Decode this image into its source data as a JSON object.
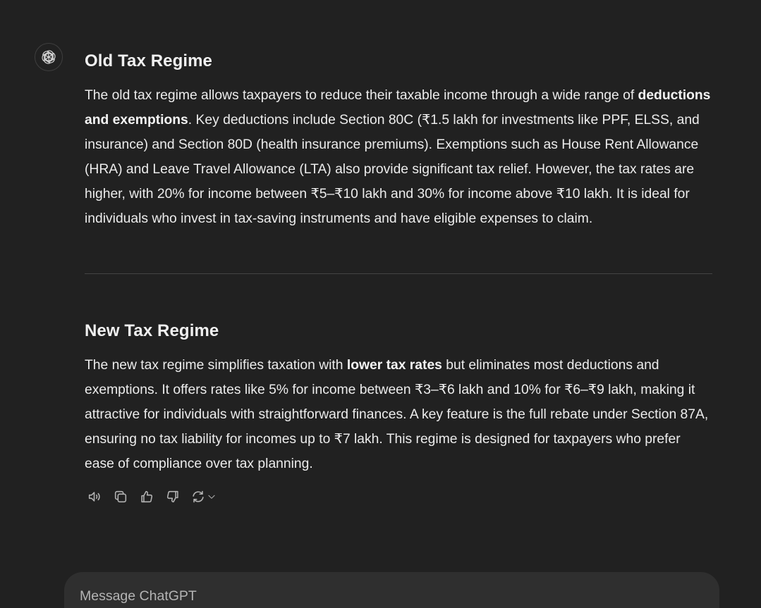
{
  "assistant": {
    "avatar_icon": "openai-logo-icon"
  },
  "sections": [
    {
      "title": "Old Tax Regime",
      "p_before": "The old tax regime allows taxpayers to reduce their taxable income through a wide range of ",
      "p_bold": "deductions and exemptions",
      "p_after": ". Key deductions include Section 80C (₹1.5 lakh for investments like PPF, ELSS, and insurance) and Section 80D (health insurance premiums). Exemptions such as House Rent Allowance (HRA) and Leave Travel Allowance (LTA) also provide significant tax relief. However, the tax rates are higher, with 20% for income between ₹5–₹10 lakh and 30% for income above ₹10 lakh. It is ideal for individuals who invest in tax-saving instruments and have eligible expenses to claim."
    },
    {
      "title": "New Tax Regime",
      "p_before": "The new tax regime simplifies taxation with ",
      "p_bold": "lower tax rates",
      "p_after": " but eliminates most deductions and exemptions. It offers rates like 5% for income between ₹3–₹6 lakh and 10% for ₹6–₹9 lakh, making it attractive for individuals with straightforward finances. A key feature is the full rebate under Section 87A, ensuring no tax liability for incomes up to ₹7 lakh. This regime is designed for taxpayers who prefer ease of compliance over tax planning."
    }
  ],
  "actions": {
    "icons": [
      "read-aloud-icon",
      "copy-icon",
      "thumbs-up-icon",
      "thumbs-down-icon",
      "regenerate-icon",
      "chevron-down-icon"
    ]
  },
  "composer": {
    "placeholder": "Message ChatGPT"
  },
  "colors": {
    "background": "#212121",
    "composer": "#2f2f2f",
    "text": "#ececec",
    "icon": "#b4b4b4"
  }
}
